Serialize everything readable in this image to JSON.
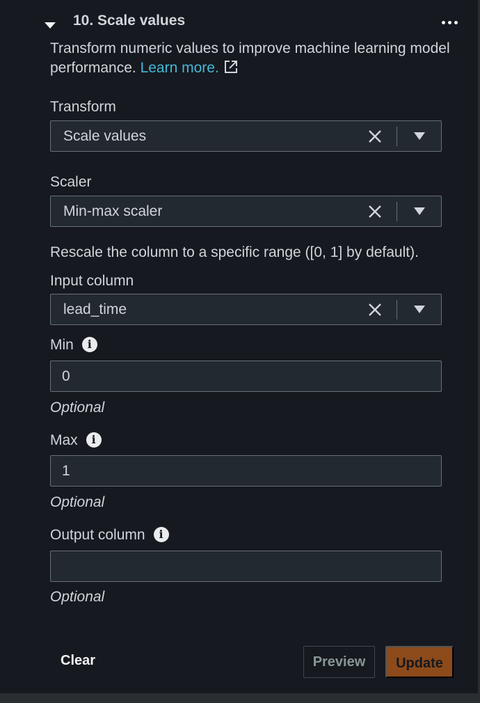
{
  "step": {
    "title": "10. Scale values",
    "description": "Transform numeric values to improve machine learning model performance.",
    "learn_more": "Learn more."
  },
  "transform": {
    "label": "Transform",
    "value": "Scale values"
  },
  "scaler": {
    "label": "Scaler",
    "value": "Min-max scaler"
  },
  "scaler_help": "Rescale the column to a specific range ([0, 1] by default).",
  "input_column": {
    "label": "Input column",
    "value": "lead_time"
  },
  "min": {
    "label": "Min",
    "value": "0",
    "hint": "Optional"
  },
  "max": {
    "label": "Max",
    "value": "1",
    "hint": "Optional"
  },
  "output_column": {
    "label": "Output column",
    "value": "",
    "hint": "Optional"
  },
  "footer": {
    "clear": "Clear",
    "preview": "Preview",
    "update": "Update"
  },
  "colors": {
    "link": "#44b9d6",
    "update_bg": "#8d4a1a",
    "panel_bg": "#16191f",
    "field_bg": "#232930"
  },
  "icons": {
    "collapse": "caret-down-icon",
    "menu": "more-horizontal-icon",
    "external": "external-link-icon",
    "info": "info-icon",
    "clear": "close-icon",
    "dropdown": "dropdown-arrow-icon"
  }
}
